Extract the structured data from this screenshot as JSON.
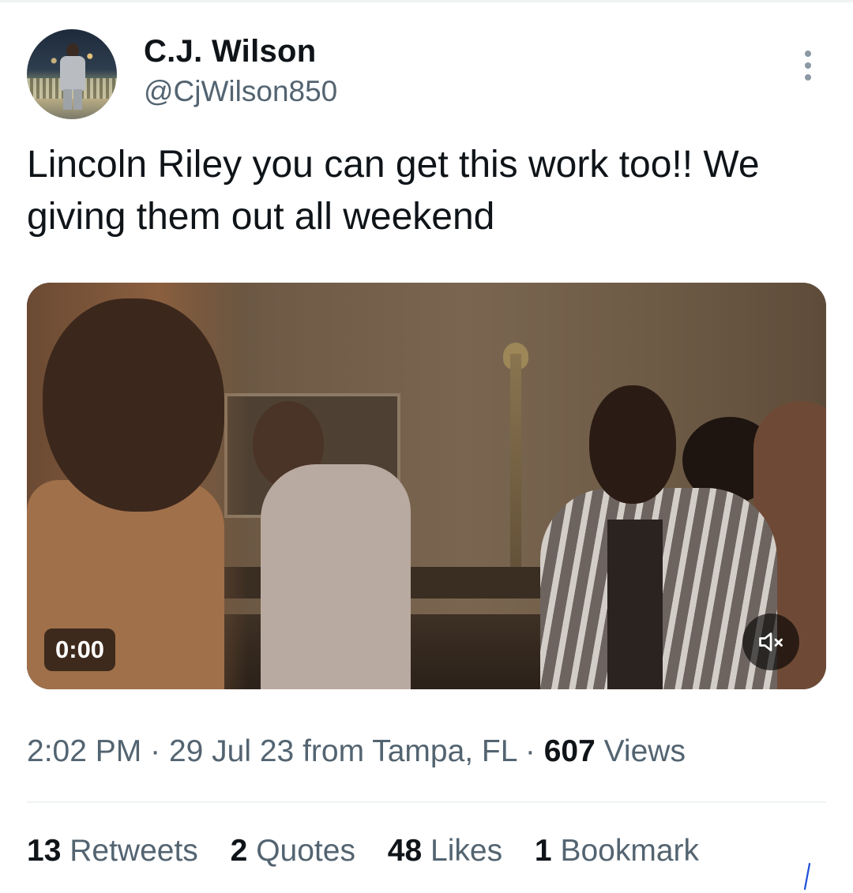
{
  "tweet": {
    "author": {
      "name": "C.J. Wilson",
      "handle": "@CjWilson850",
      "avatar_icon": "profile-photo"
    },
    "text": "Lincoln Riley you can get this work too!! We giving them out all weekend",
    "media": {
      "type": "video",
      "timestamp": "0:00",
      "mute_icon": "volume-muted-icon"
    },
    "meta": {
      "time": "2:02 PM",
      "separator": "·",
      "date": "29 Jul 23",
      "from_label": "from Tampa, FL",
      "views_count": "607",
      "views_label": "Views"
    },
    "stats": [
      {
        "count": "13",
        "label": "Retweets"
      },
      {
        "count": "2",
        "label": "Quotes"
      },
      {
        "count": "48",
        "label": "Likes"
      },
      {
        "count": "1",
        "label": "Bookmark"
      }
    ]
  },
  "colors": {
    "text_primary": "#0f1419",
    "text_secondary": "#536471",
    "divider": "#eff3f4",
    "pen_mark": "#1d4fd8"
  }
}
